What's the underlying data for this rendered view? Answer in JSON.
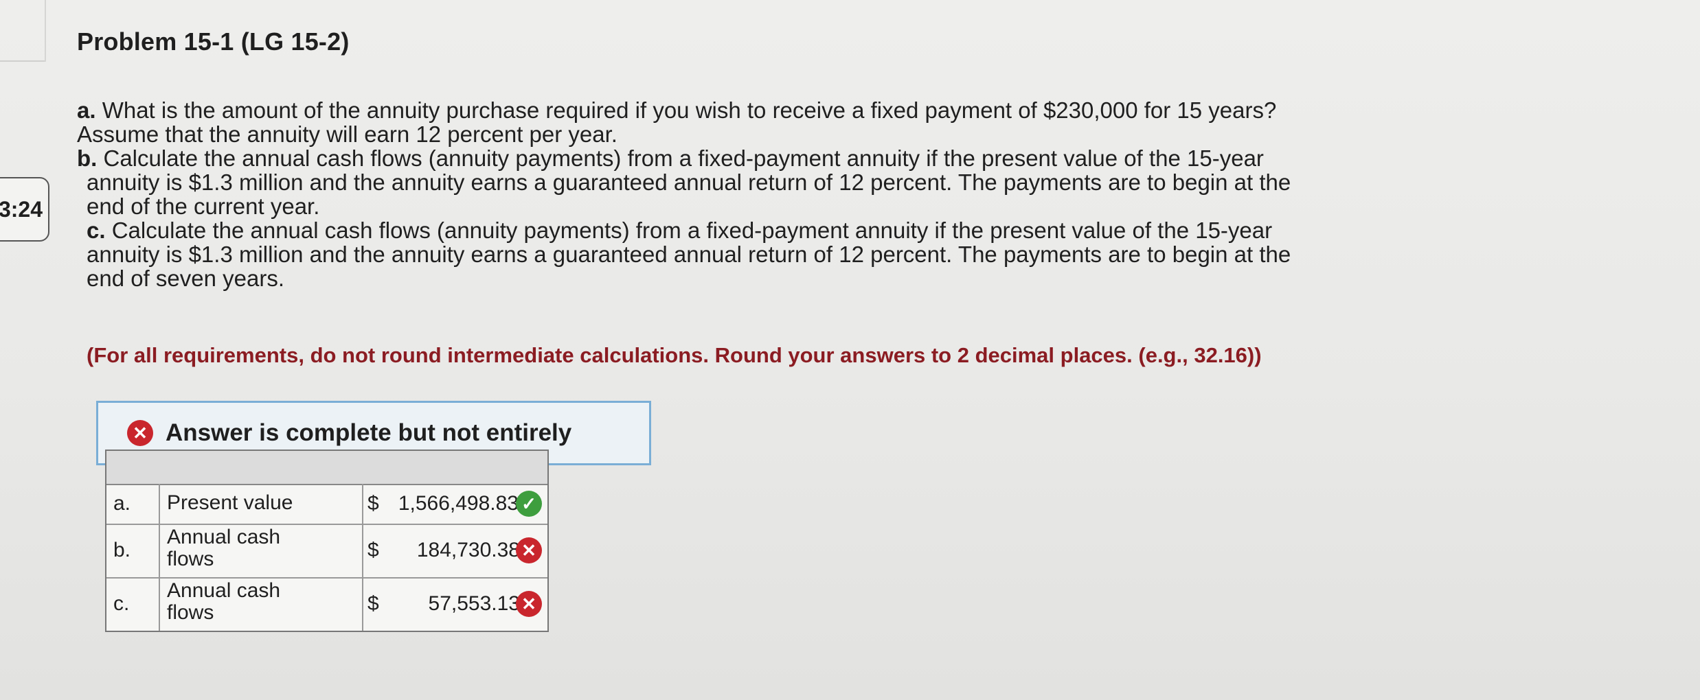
{
  "timer": "3:24",
  "title": "Problem 15-1 (LG 15-2)",
  "questions": {
    "a_label": "a.",
    "a_line1": "What is the amount of the annuity purchase required if you wish to receive a fixed payment of $230,000 for 15 years?",
    "a_line2": "Assume that the annuity will earn 12 percent per year.",
    "b_label": "b.",
    "b_line1": "Calculate the annual cash flows (annuity payments) from a fixed-payment annuity if the present value of the 15-year",
    "b_line2": "annuity is $1.3 million and the annuity earns a guaranteed annual return of 12 percent. The payments are to begin at the",
    "b_line3": "end of the current year.",
    "c_label": "c.",
    "c_line1": "Calculate the annual cash flows (annuity payments) from a fixed-payment annuity if the present value of the 15-year",
    "c_line2": "annuity is $1.3 million and the annuity earns a guaranteed annual return of 12 percent. The payments are to begin at the",
    "c_line3": "end of seven years."
  },
  "instructions": "(For all requirements, do not round intermediate calculations. Round your answers to 2 decimal places. (e.g., 32.16))",
  "status": "Answer is complete but not entirely",
  "answers": [
    {
      "part": "a.",
      "label": "Present value",
      "currency": "$",
      "value": "1,566,498.83",
      "correct": true
    },
    {
      "part": "b.",
      "label_1": "Annual cash",
      "label_2": "flows",
      "currency": "$",
      "value": "184,730.38",
      "correct": false
    },
    {
      "part": "c.",
      "label_1": "Annual cash",
      "label_2": "flows",
      "currency": "$",
      "value": "57,553.13",
      "correct": false
    }
  ],
  "colors": {
    "incorrect": "#c9262d",
    "correct": "#3e9e3e",
    "instruction_text": "#8b1c22",
    "status_border": "#7aaed6"
  }
}
